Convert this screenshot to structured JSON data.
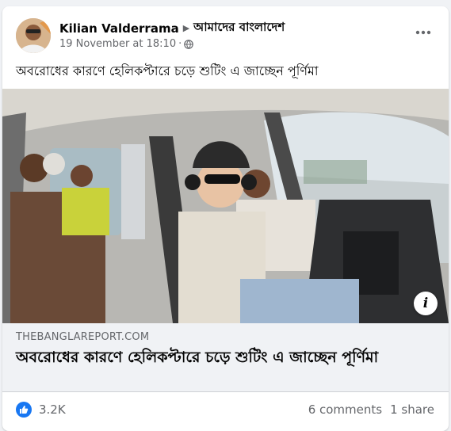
{
  "post": {
    "author": "Kilian Valderrama",
    "group": "আমাদের বাংলাদেশ",
    "date": "19 November at 18:10",
    "separator": "·",
    "text": "অবরোধের কারণে হেলিকপ্টারে চড়ে শুটিং এ জাচ্ছেন পূর্ণিমা",
    "icons": {
      "arrow": "caret-right-icon",
      "privacy": "globe-icon",
      "more": "more-horizontal-icon"
    }
  },
  "link_preview": {
    "domain": "THEBANGLAREPORT.COM",
    "title": "অবরোধের কারণে হেলিকপ্টারে চড়ে শুটিং এ জাচ্ছেন পূর্ণিমা",
    "info_icon": "info-icon",
    "info_glyph": "i"
  },
  "stats": {
    "reactions": "3.2K",
    "comments": "6 comments",
    "shares": "1 share",
    "reaction_icon": "like-icon"
  },
  "colors": {
    "accent": "#1877f2",
    "secondary_text": "#65676b",
    "primary_text": "#050505",
    "link_background": "#f0f2f5"
  }
}
